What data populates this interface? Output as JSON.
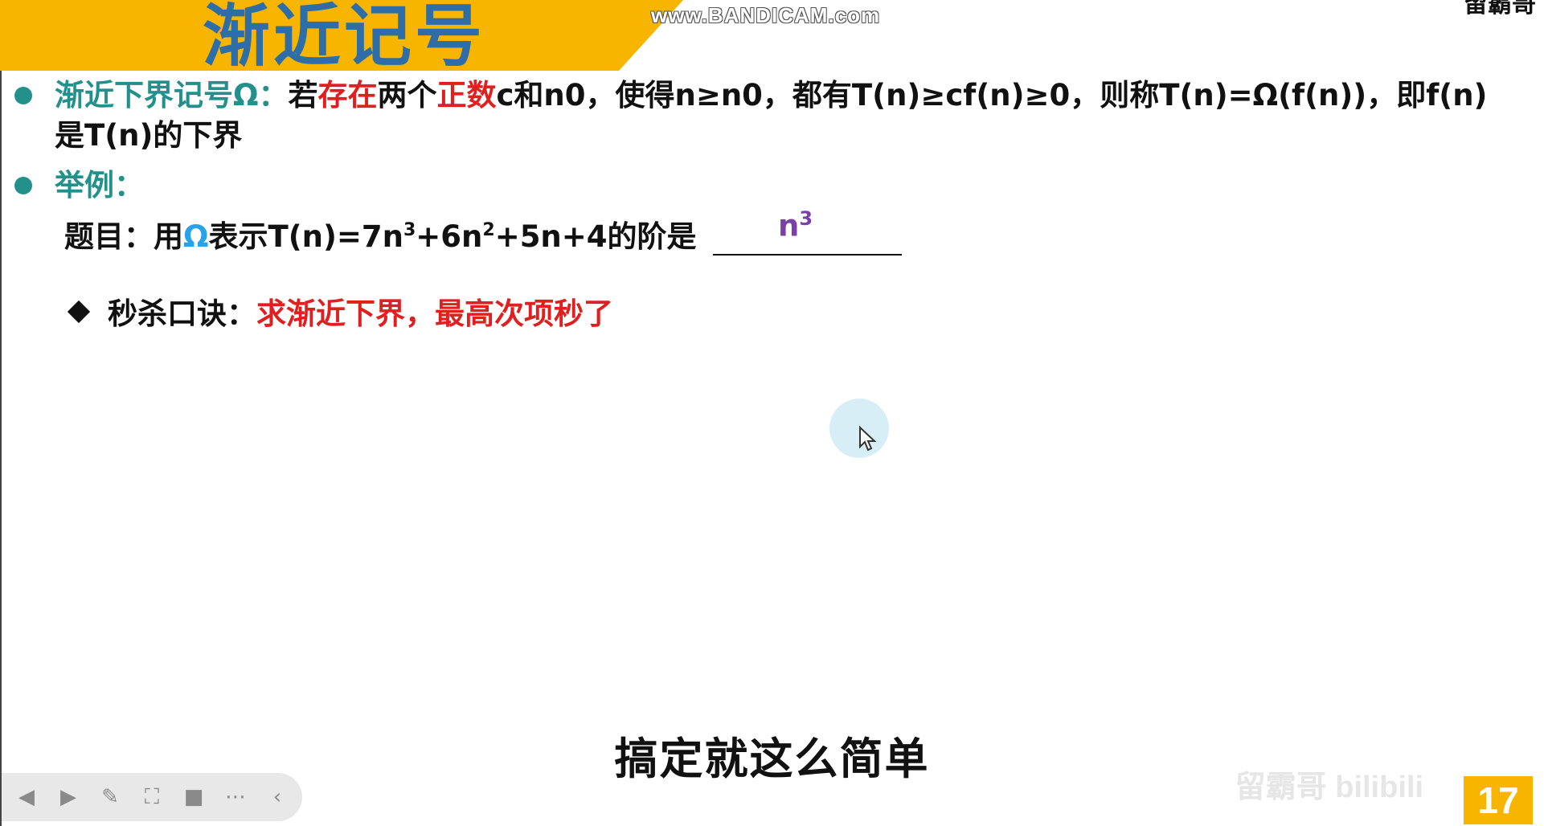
{
  "slide": {
    "title": "渐近记号",
    "author": "留霸哥",
    "watermark": "www.BANDICAM.com",
    "definition": {
      "term": "渐近下界记号Ω：",
      "p1": "若",
      "exists": "存在",
      "p2": "两个",
      "positive": "正数",
      "p3": "c和n0，使得n≥n0，都有T(n)≥cf(n)≥0，则称T(n)=Ω(f(n))，即f(n)",
      "p4": "是T(n)的下界"
    },
    "example_label": "举例：",
    "question": {
      "p1": "题目：用",
      "omega": "Ω",
      "p2": "表示T(n)=7n",
      "e1": "3",
      "p3": "+6n",
      "e2": "2",
      "p4": "+5n+4的阶是"
    },
    "answer": {
      "base": "n",
      "exp": "3"
    },
    "tip": {
      "label": "秒杀口诀：",
      "text": "求渐近下界，最高次项秒了"
    },
    "subtitle": "搞定就这么简单",
    "corner_watermark": "留霸哥 bilibili",
    "page_number": "17"
  },
  "toolbar": {
    "buttons": [
      {
        "name": "prev-button",
        "icon": "prev-icon",
        "glyph": "◀"
      },
      {
        "name": "next-button",
        "icon": "next-icon",
        "glyph": "▶"
      },
      {
        "name": "pen-button",
        "icon": "pen-icon",
        "glyph": "✎"
      },
      {
        "name": "screenshot-button",
        "icon": "screenshot-icon",
        "glyph": "⛶"
      },
      {
        "name": "camera-button",
        "icon": "camera-icon",
        "glyph": "■"
      },
      {
        "name": "more-button",
        "icon": "more-icon",
        "glyph": "⋯"
      },
      {
        "name": "collapse-button",
        "icon": "chevron-left-icon",
        "glyph": "‹"
      }
    ]
  },
  "colors": {
    "banner": "#f7b500",
    "title": "#2e6ea8",
    "teal": "#23908c",
    "red": "#e02020",
    "blue": "#2aa2e8",
    "purple": "#7b3fa8"
  }
}
